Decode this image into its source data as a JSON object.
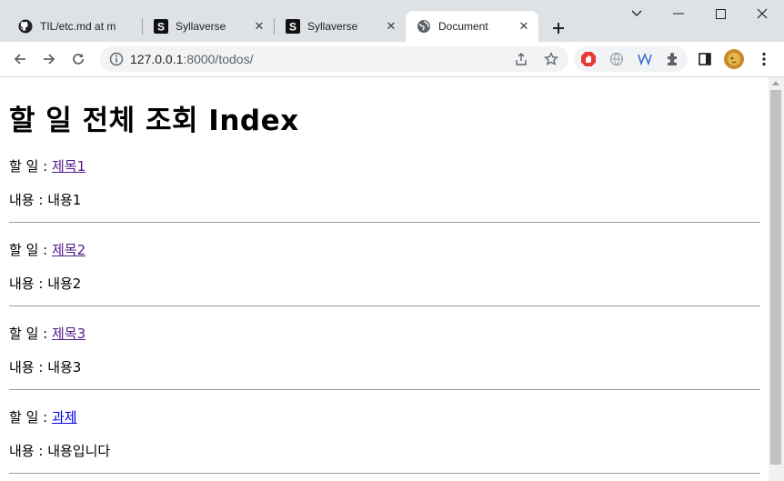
{
  "browser": {
    "tabs": [
      {
        "title": "TIL/etc.md at m",
        "icon": "github-icon"
      },
      {
        "title": "Syllaverse",
        "icon": "syllaverse-icon"
      },
      {
        "title": "Syllaverse",
        "icon": "syllaverse-icon"
      },
      {
        "title": "Document",
        "icon": "globe-icon"
      }
    ],
    "url_host": "127.0.0.1",
    "url_rest": ":8000/todos/"
  },
  "page": {
    "heading": "할 일 전체 조회 Index",
    "todo_label": "할 일 : ",
    "content_label": "내용 : ",
    "todos": [
      {
        "title": "제목1",
        "content": "내용1",
        "visited": true
      },
      {
        "title": "제목2",
        "content": "내용2",
        "visited": true
      },
      {
        "title": "제목3",
        "content": "내용3",
        "visited": true
      },
      {
        "title": "과제",
        "content": "내용입니다",
        "visited": false
      }
    ]
  },
  "colors": {
    "tabstrip_bg": "#dee1e6",
    "visited_link": "#551a8b",
    "link": "#0000ee"
  }
}
